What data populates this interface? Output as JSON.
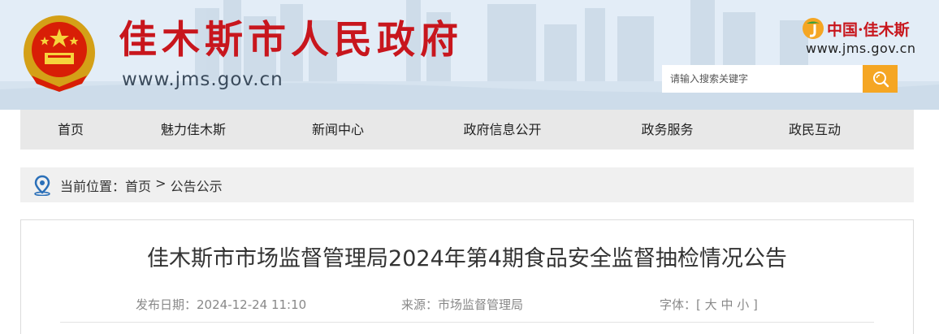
{
  "header": {
    "site_title": "佳木斯市人民政府",
    "site_url": "www.jms.gov.cn",
    "brand_text": "中国·佳木斯",
    "brand_url": "www.jms.gov.cn",
    "title_color": "#c8161d"
  },
  "search": {
    "placeholder": "请输入搜索关键字",
    "button_color": "#f5a623",
    "icon": "search-icon"
  },
  "nav": {
    "items": [
      "首页",
      "魅力佳木斯",
      "新闻中心",
      "政府信息公开",
      "政务服务",
      "政民互动"
    ]
  },
  "breadcrumb": {
    "icon": "location-pin-icon",
    "prefix": "当前位置：",
    "home": "首页",
    "separator": " > ",
    "current": "公告公示"
  },
  "article": {
    "title": "佳木斯市市场监督管理局2024年第4期食品安全监督抽检情况公告",
    "publish_label": "发布日期：",
    "publish_date": "2024-12-24 11:10",
    "source_label": "来源：",
    "source": "市场监督管理局",
    "font_label": "字体：",
    "font_open": "[ ",
    "font_large": "大",
    "font_medium": "中",
    "font_small": "小",
    "font_close": " ]"
  }
}
